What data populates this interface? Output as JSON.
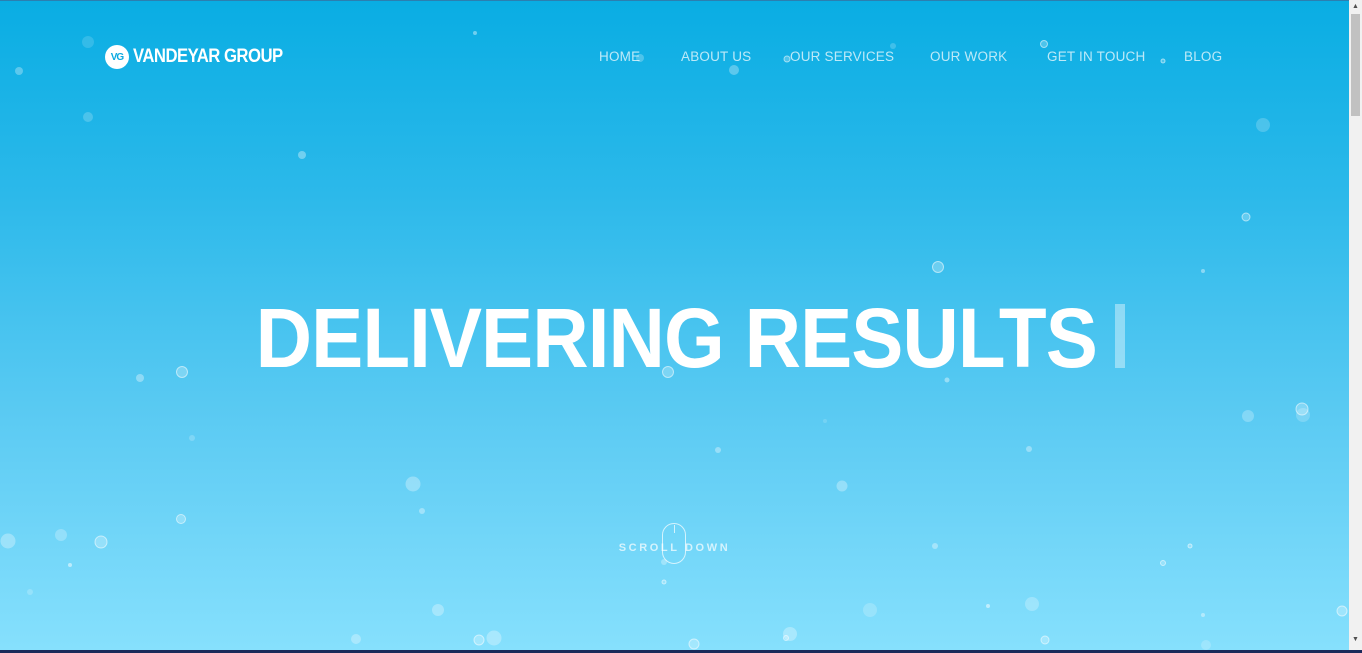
{
  "brand": {
    "logo_mark": "VG",
    "name": "VANDEYAR GROUP"
  },
  "nav": {
    "items": [
      {
        "label": "HOME"
      },
      {
        "label": "ABOUT US"
      },
      {
        "label": "OUR SERVICES"
      },
      {
        "label": "OUR WORK"
      },
      {
        "label": "GET IN TOUCH"
      },
      {
        "label": "BLOG"
      }
    ]
  },
  "hero": {
    "headline": "DELIVERING RESULTS",
    "scroll_label": "SCROLL DOWN"
  },
  "icons": {
    "logo": "vg-logo-icon",
    "mouse": "mouse-scroll-icon",
    "scroll_up": "scroll-up-arrow-icon",
    "scroll_down": "scroll-down-arrow-icon"
  },
  "colors": {
    "gradient_top": "#09ade3",
    "gradient_bottom": "#86e0fd",
    "text": "#ffffff"
  }
}
